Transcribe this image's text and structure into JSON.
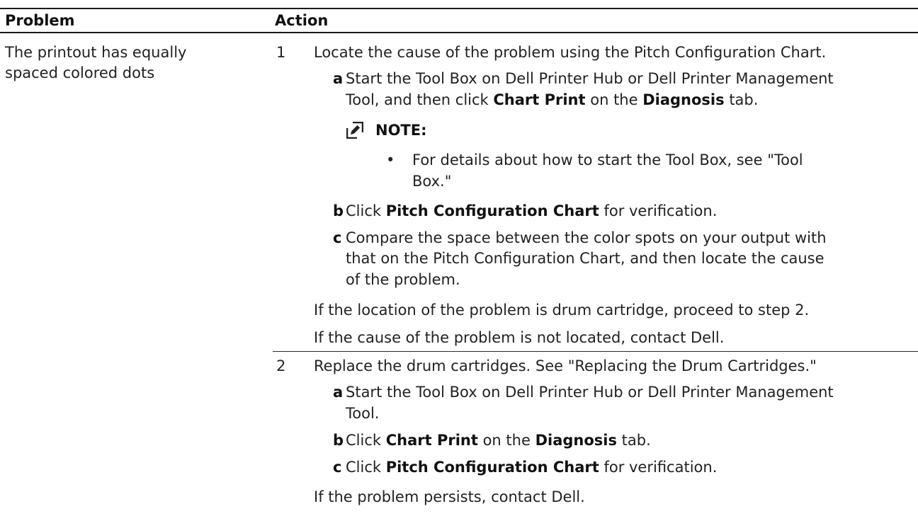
{
  "header": {
    "problem": "Problem",
    "action": "Action"
  },
  "problem": {
    "line1": "The printout has equally",
    "line2": "spaced colored dots"
  },
  "step1": {
    "num": "1",
    "text": "Locate the cause of the problem using the Pitch Configuration Chart.",
    "a": {
      "letter": "a",
      "l1": "Start the Tool Box on Dell Printer Hub or Dell Printer Management",
      "l2_pre": "Tool, and then click ",
      "l2_b1": "Chart Print",
      "l2_mid": " on the ",
      "l2_b2": "Diagnosis",
      "l2_post": " tab."
    },
    "note": {
      "label": "NOTE:",
      "bullet": "•",
      "l1": "For details about how to start the Tool Box, see \"Tool",
      "l2": "Box.\""
    },
    "b": {
      "letter": "b",
      "pre": "Click ",
      "bold": "Pitch Configuration Chart",
      "post": " for verification."
    },
    "c": {
      "letter": "c",
      "l1": "Compare the space between the color spots on your output with",
      "l2": "that on the Pitch Configuration Chart, and then locate the cause",
      "l3": "of the problem."
    },
    "if1": "If the location of the problem is drum cartridge, proceed to step 2.",
    "if2": "If the cause of the problem is not located, contact Dell."
  },
  "step2": {
    "num": "2",
    "text": "Replace the drum cartridges. See \"Replacing the Drum Cartridges.\"",
    "a": {
      "letter": "a",
      "l1": "Start the Tool Box on Dell Printer Hub or Dell Printer Management",
      "l2": "Tool."
    },
    "b": {
      "letter": "b",
      "pre": "Click ",
      "b1": "Chart Print",
      "mid": " on the ",
      "b2": "Diagnosis",
      "post": " tab."
    },
    "c": {
      "letter": "c",
      "pre": "Click ",
      "bold": "Pitch Configuration Chart",
      "post": " for verification."
    },
    "if1": "If the problem persists, contact Dell."
  }
}
